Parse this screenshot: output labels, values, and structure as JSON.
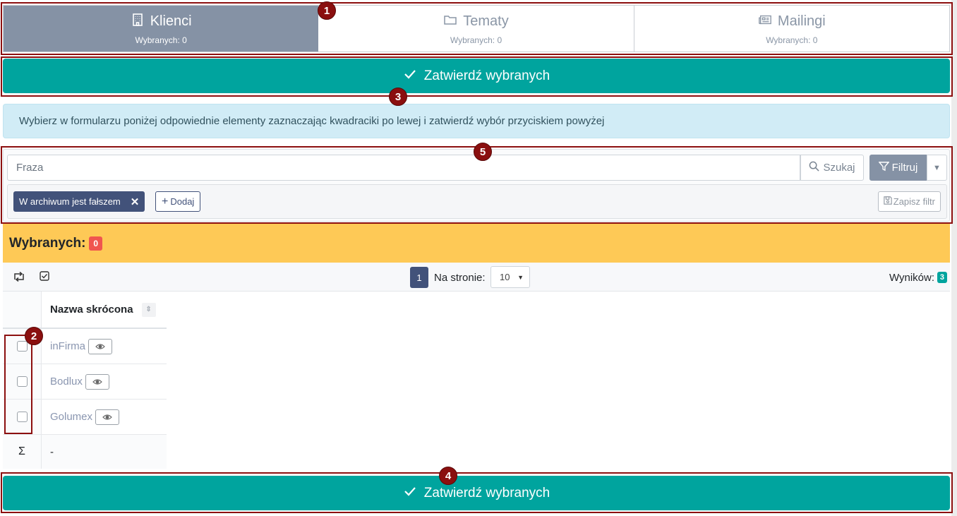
{
  "tabs": [
    {
      "icon": "building-icon",
      "label": "Klienci",
      "sub": "Wybranych: 0",
      "active": true
    },
    {
      "icon": "folder-icon",
      "label": "Tematy",
      "sub": "Wybranych: 0",
      "active": false
    },
    {
      "icon": "newspaper-icon",
      "label": "Mailingi",
      "sub": "Wybranych: 0",
      "active": false
    }
  ],
  "confirm_label": "Zatwierdź wybranych",
  "info_text": "Wybierz w formularzu poniżej odpowiednie elementy zaznaczając kwadraciki po lewej i zatwierdź wybór przyciskiem powyżej",
  "filter": {
    "search_placeholder": "Fraza",
    "search_button": "Szukaj",
    "filter_button": "Filtruj",
    "active_filter": "W archiwum jest fałszem",
    "add_button": "Dodaj",
    "save_filter": "Zapisz filtr"
  },
  "selected": {
    "label": "Wybranych:",
    "count": "0"
  },
  "toolbar": {
    "page": "1",
    "per_page_label": "Na stronie:",
    "per_page_value": "10",
    "results_label": "Wyników:",
    "results_count": "3"
  },
  "table": {
    "header": "Nazwa skrócona",
    "rows": [
      "inFirma",
      "Bodlux",
      "Golumex"
    ],
    "sum_symbol": "Σ",
    "sum_value": "-"
  },
  "annotations": [
    "1",
    "2",
    "3",
    "4",
    "5"
  ],
  "colors": {
    "accent": "#00a49e",
    "tab_active": "#8592a5",
    "chip": "#42527a",
    "selected_bar": "#fec956",
    "badge_red": "#f0554f",
    "annotation": "#8c0f0f"
  }
}
